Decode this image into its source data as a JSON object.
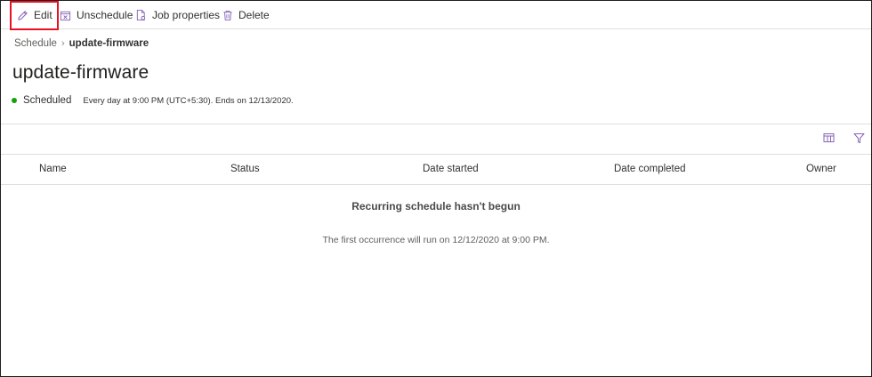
{
  "toolbar": {
    "edit_label": "Edit",
    "unschedule_label": "Unschedule",
    "job_properties_label": "Job properties",
    "delete_label": "Delete"
  },
  "breadcrumb": {
    "parent": "Schedule",
    "current": "update-firmware"
  },
  "page": {
    "title": "update-firmware",
    "status": "Scheduled",
    "schedule_description": "Every day at 9:00 PM (UTC+5:30). Ends on 12/13/2020."
  },
  "table": {
    "columns": [
      "Name",
      "Status",
      "Date started",
      "Date completed",
      "Owner"
    ]
  },
  "empty_state": {
    "title": "Recurring schedule hasn't begun",
    "description": "The first occurrence will run on 12/12/2020 at 9:00 PM."
  },
  "colors": {
    "accent": "#8764b8",
    "status_green": "#13a10e",
    "highlight_red": "#e81123"
  },
  "icons": {
    "edit": "pencil-icon",
    "unschedule": "calendar-x-icon",
    "job_properties": "document-gear-icon",
    "delete": "trash-icon",
    "column_options": "column-options-icon",
    "filter": "filter-icon"
  }
}
